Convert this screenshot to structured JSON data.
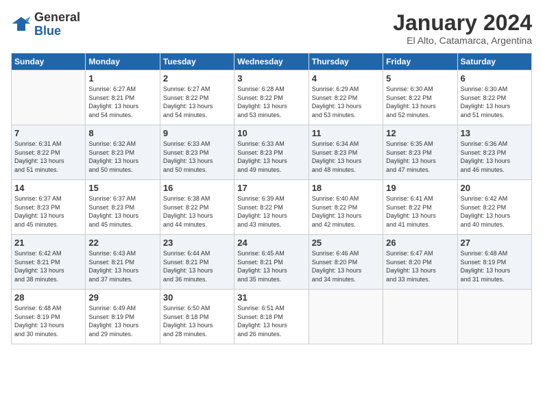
{
  "logo": {
    "line1": "General",
    "line2": "Blue"
  },
  "title": "January 2024",
  "subtitle": "El Alto, Catamarca, Argentina",
  "days_header": [
    "Sunday",
    "Monday",
    "Tuesday",
    "Wednesday",
    "Thursday",
    "Friday",
    "Saturday"
  ],
  "weeks": [
    [
      {
        "day": "",
        "info": ""
      },
      {
        "day": "1",
        "info": "Sunrise: 6:27 AM\nSunset: 8:21 PM\nDaylight: 13 hours\nand 54 minutes."
      },
      {
        "day": "2",
        "info": "Sunrise: 6:27 AM\nSunset: 8:22 PM\nDaylight: 13 hours\nand 54 minutes."
      },
      {
        "day": "3",
        "info": "Sunrise: 6:28 AM\nSunset: 8:22 PM\nDaylight: 13 hours\nand 53 minutes."
      },
      {
        "day": "4",
        "info": "Sunrise: 6:29 AM\nSunset: 8:22 PM\nDaylight: 13 hours\nand 53 minutes."
      },
      {
        "day": "5",
        "info": "Sunrise: 6:30 AM\nSunset: 8:22 PM\nDaylight: 13 hours\nand 52 minutes."
      },
      {
        "day": "6",
        "info": "Sunrise: 6:30 AM\nSunset: 8:22 PM\nDaylight: 13 hours\nand 51 minutes."
      }
    ],
    [
      {
        "day": "7",
        "info": "Sunrise: 6:31 AM\nSunset: 8:22 PM\nDaylight: 13 hours\nand 51 minutes."
      },
      {
        "day": "8",
        "info": "Sunrise: 6:32 AM\nSunset: 8:23 PM\nDaylight: 13 hours\nand 50 minutes."
      },
      {
        "day": "9",
        "info": "Sunrise: 6:33 AM\nSunset: 8:23 PM\nDaylight: 13 hours\nand 50 minutes."
      },
      {
        "day": "10",
        "info": "Sunrise: 6:33 AM\nSunset: 8:23 PM\nDaylight: 13 hours\nand 49 minutes."
      },
      {
        "day": "11",
        "info": "Sunrise: 6:34 AM\nSunset: 8:23 PM\nDaylight: 13 hours\nand 48 minutes."
      },
      {
        "day": "12",
        "info": "Sunrise: 6:35 AM\nSunset: 8:23 PM\nDaylight: 13 hours\nand 47 minutes."
      },
      {
        "day": "13",
        "info": "Sunrise: 6:36 AM\nSunset: 8:23 PM\nDaylight: 13 hours\nand 46 minutes."
      }
    ],
    [
      {
        "day": "14",
        "info": "Sunrise: 6:37 AM\nSunset: 8:23 PM\nDaylight: 13 hours\nand 45 minutes."
      },
      {
        "day": "15",
        "info": "Sunrise: 6:37 AM\nSunset: 8:23 PM\nDaylight: 13 hours\nand 45 minutes."
      },
      {
        "day": "16",
        "info": "Sunrise: 6:38 AM\nSunset: 8:22 PM\nDaylight: 13 hours\nand 44 minutes."
      },
      {
        "day": "17",
        "info": "Sunrise: 6:39 AM\nSunset: 8:22 PM\nDaylight: 13 hours\nand 43 minutes."
      },
      {
        "day": "18",
        "info": "Sunrise: 6:40 AM\nSunset: 8:22 PM\nDaylight: 13 hours\nand 42 minutes."
      },
      {
        "day": "19",
        "info": "Sunrise: 6:41 AM\nSunset: 8:22 PM\nDaylight: 13 hours\nand 41 minutes."
      },
      {
        "day": "20",
        "info": "Sunrise: 6:42 AM\nSunset: 8:22 PM\nDaylight: 13 hours\nand 40 minutes."
      }
    ],
    [
      {
        "day": "21",
        "info": "Sunrise: 6:42 AM\nSunset: 8:21 PM\nDaylight: 13 hours\nand 38 minutes."
      },
      {
        "day": "22",
        "info": "Sunrise: 6:43 AM\nSunset: 8:21 PM\nDaylight: 13 hours\nand 37 minutes."
      },
      {
        "day": "23",
        "info": "Sunrise: 6:44 AM\nSunset: 8:21 PM\nDaylight: 13 hours\nand 36 minutes."
      },
      {
        "day": "24",
        "info": "Sunrise: 6:45 AM\nSunset: 8:21 PM\nDaylight: 13 hours\nand 35 minutes."
      },
      {
        "day": "25",
        "info": "Sunrise: 6:46 AM\nSunset: 8:20 PM\nDaylight: 13 hours\nand 34 minutes."
      },
      {
        "day": "26",
        "info": "Sunrise: 6:47 AM\nSunset: 8:20 PM\nDaylight: 13 hours\nand 33 minutes."
      },
      {
        "day": "27",
        "info": "Sunrise: 6:48 AM\nSunset: 8:19 PM\nDaylight: 13 hours\nand 31 minutes."
      }
    ],
    [
      {
        "day": "28",
        "info": "Sunrise: 6:48 AM\nSunset: 8:19 PM\nDaylight: 13 hours\nand 30 minutes."
      },
      {
        "day": "29",
        "info": "Sunrise: 6:49 AM\nSunset: 8:19 PM\nDaylight: 13 hours\nand 29 minutes."
      },
      {
        "day": "30",
        "info": "Sunrise: 6:50 AM\nSunset: 8:18 PM\nDaylight: 13 hours\nand 28 minutes."
      },
      {
        "day": "31",
        "info": "Sunrise: 6:51 AM\nSunset: 8:18 PM\nDaylight: 13 hours\nand 26 minutes."
      },
      {
        "day": "",
        "info": ""
      },
      {
        "day": "",
        "info": ""
      },
      {
        "day": "",
        "info": ""
      }
    ]
  ]
}
